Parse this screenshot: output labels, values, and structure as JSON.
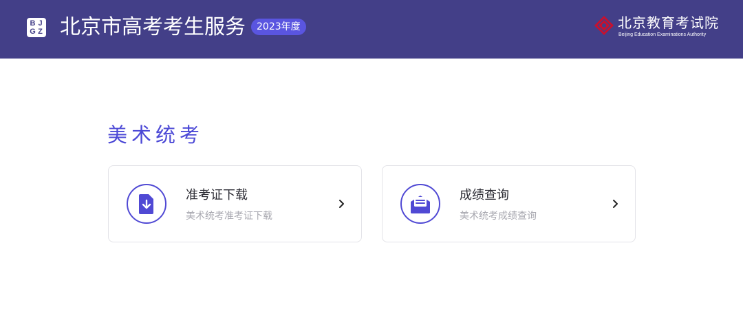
{
  "header": {
    "logo_letters": [
      "B",
      "J",
      "G",
      "Z"
    ],
    "title": "北京市高考考生服务",
    "year_badge": "2023年度",
    "org_name": "北京教育考试院",
    "org_name_en": "Beijing Education Examinations Authority"
  },
  "section": {
    "title": "美术统考"
  },
  "cards": [
    {
      "title": "准考证下载",
      "subtitle": "美术统考准考证下载",
      "icon": "download-doc-icon"
    },
    {
      "title": "成绩查询",
      "subtitle": "美术统考成绩查询",
      "icon": "envelope-letter-icon"
    }
  ],
  "colors": {
    "header_bg": "#433f88",
    "accent": "#4c49d6",
    "badge_bg": "#5a55e0",
    "seal_red": "#c8102e"
  }
}
